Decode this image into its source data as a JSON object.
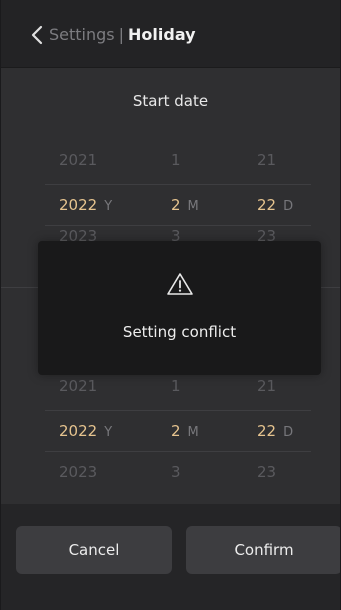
{
  "header": {
    "parent": "Settings",
    "separator": "|",
    "current": "Holiday"
  },
  "start": {
    "title": "Start date",
    "rows": [
      {
        "year": "2021",
        "month": "1",
        "day": "21"
      },
      {
        "year": "2022",
        "month": "2",
        "day": "22"
      },
      {
        "year": "2023",
        "month": "3",
        "day": "23"
      }
    ]
  },
  "end": {
    "rows": [
      {
        "year": "2021",
        "month": "1",
        "day": "21"
      },
      {
        "year": "2022",
        "month": "2",
        "day": "22"
      },
      {
        "year": "2023",
        "month": "3",
        "day": "23"
      }
    ]
  },
  "units": {
    "year": "Y",
    "month": "M",
    "day": "D"
  },
  "modal": {
    "message": "Setting conflict"
  },
  "buttons": {
    "cancel": "Cancel",
    "confirm": "Confirm"
  },
  "colors": {
    "selected_value": "#e6c48f",
    "background": "#2f2f31",
    "modal_background": "#19191a"
  }
}
